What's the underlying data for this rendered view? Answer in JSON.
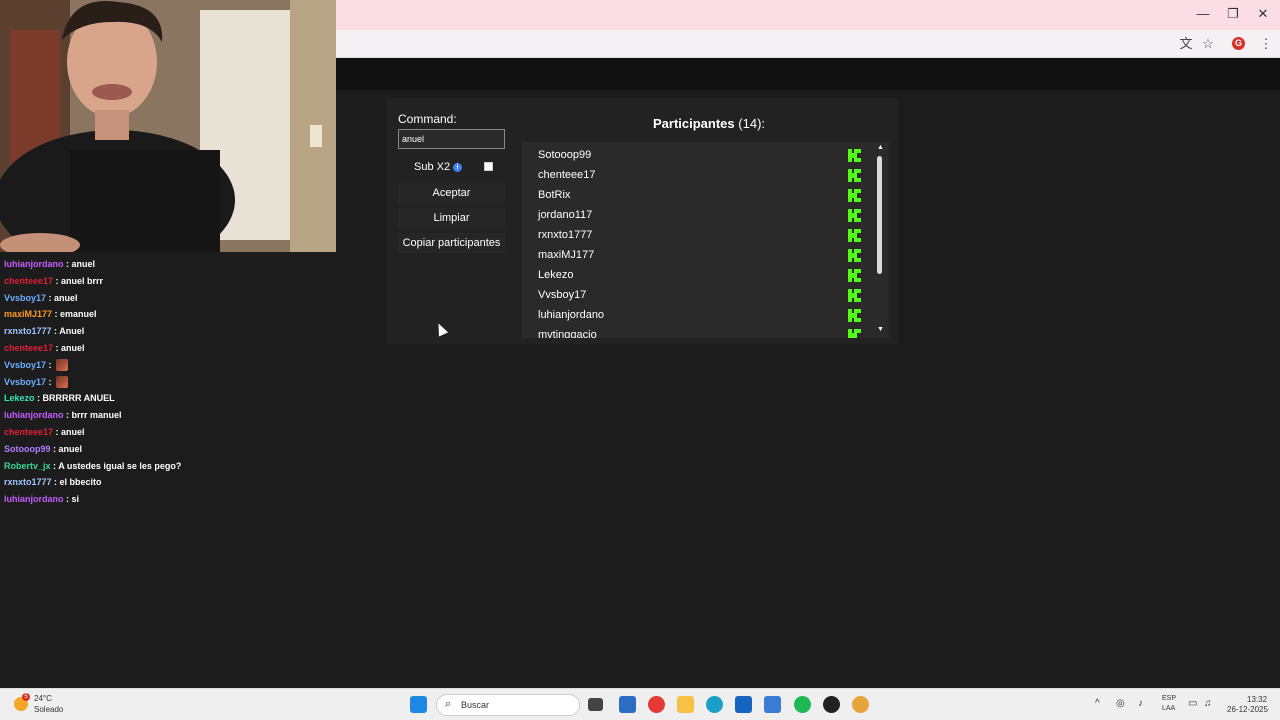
{
  "browser": {
    "controls": {
      "minimize": "—",
      "restore": "❐",
      "close": "✕"
    },
    "profile_initial": "G"
  },
  "chat": [
    {
      "user": "luhianjordano",
      "color": "#c45cff",
      "message": "anuel"
    },
    {
      "user": "chenteee17",
      "color": "#e0203a",
      "message": "anuel brrr"
    },
    {
      "user": "Vvsboy17",
      "color": "#6ab0ff",
      "message": "anuel"
    },
    {
      "user": "maxiMJ177",
      "color": "#ff9a1f",
      "message": "emanuel"
    },
    {
      "user": "rxnxto1777",
      "color": "#9fc6ff",
      "message": "Anuel"
    },
    {
      "user": "chenteee17",
      "color": "#e0203a",
      "message": "anuel"
    },
    {
      "user": "Vvsboy17",
      "color": "#6ab0ff",
      "message": "",
      "emote": true
    },
    {
      "user": "Vvsboy17",
      "color": "#6ab0ff",
      "message": "",
      "emote": true
    },
    {
      "user": "Lekezo",
      "color": "#2ee6b8",
      "message": "BRRRRR ANUEL"
    },
    {
      "user": "luhianjordano",
      "color": "#c45cff",
      "message": "brrr manuel"
    },
    {
      "user": "chenteee17",
      "color": "#e0203a",
      "message": "anuel"
    },
    {
      "user": "Sotooop99",
      "color": "#b07cff",
      "message": "anuel"
    },
    {
      "user": "Robertv_jx",
      "color": "#38d69a",
      "message": "A ustedes igual se les pego?"
    },
    {
      "user": "rxnxto1777",
      "color": "#9fc6ff",
      "message": "el bbecito"
    },
    {
      "user": "luhianjordano",
      "color": "#c45cff",
      "message": "si"
    }
  ],
  "panel": {
    "command_label": "Command:",
    "command_value": "anuel",
    "sub_label": "Sub X2",
    "info_glyph": "i",
    "sub_checked": false,
    "accept_label": "Aceptar",
    "clear_label": "Limpiar",
    "copy_label": "Copiar participantes",
    "participants_title": "Participantes",
    "participants_count": "(14):",
    "participants": [
      "Sotooop99",
      "chenteee17",
      "BotRix",
      "jordano117",
      "rxnxto1777",
      "maxiMJ177",
      "Lekezo",
      "Vvsboy17",
      "luhianjordano",
      "mvtinggacio"
    ],
    "scroll_up": "▲",
    "scroll_down": "▼",
    "kick_color": "#53fc18"
  },
  "taskbar": {
    "weather_temp": "24°C",
    "weather_desc": "Soleado",
    "weather_badge": "5",
    "search_placeholder": "Buscar",
    "lang_top": "ESP",
    "lang_bottom": "LAA",
    "time": "13:32",
    "date": "26-12-2025"
  }
}
